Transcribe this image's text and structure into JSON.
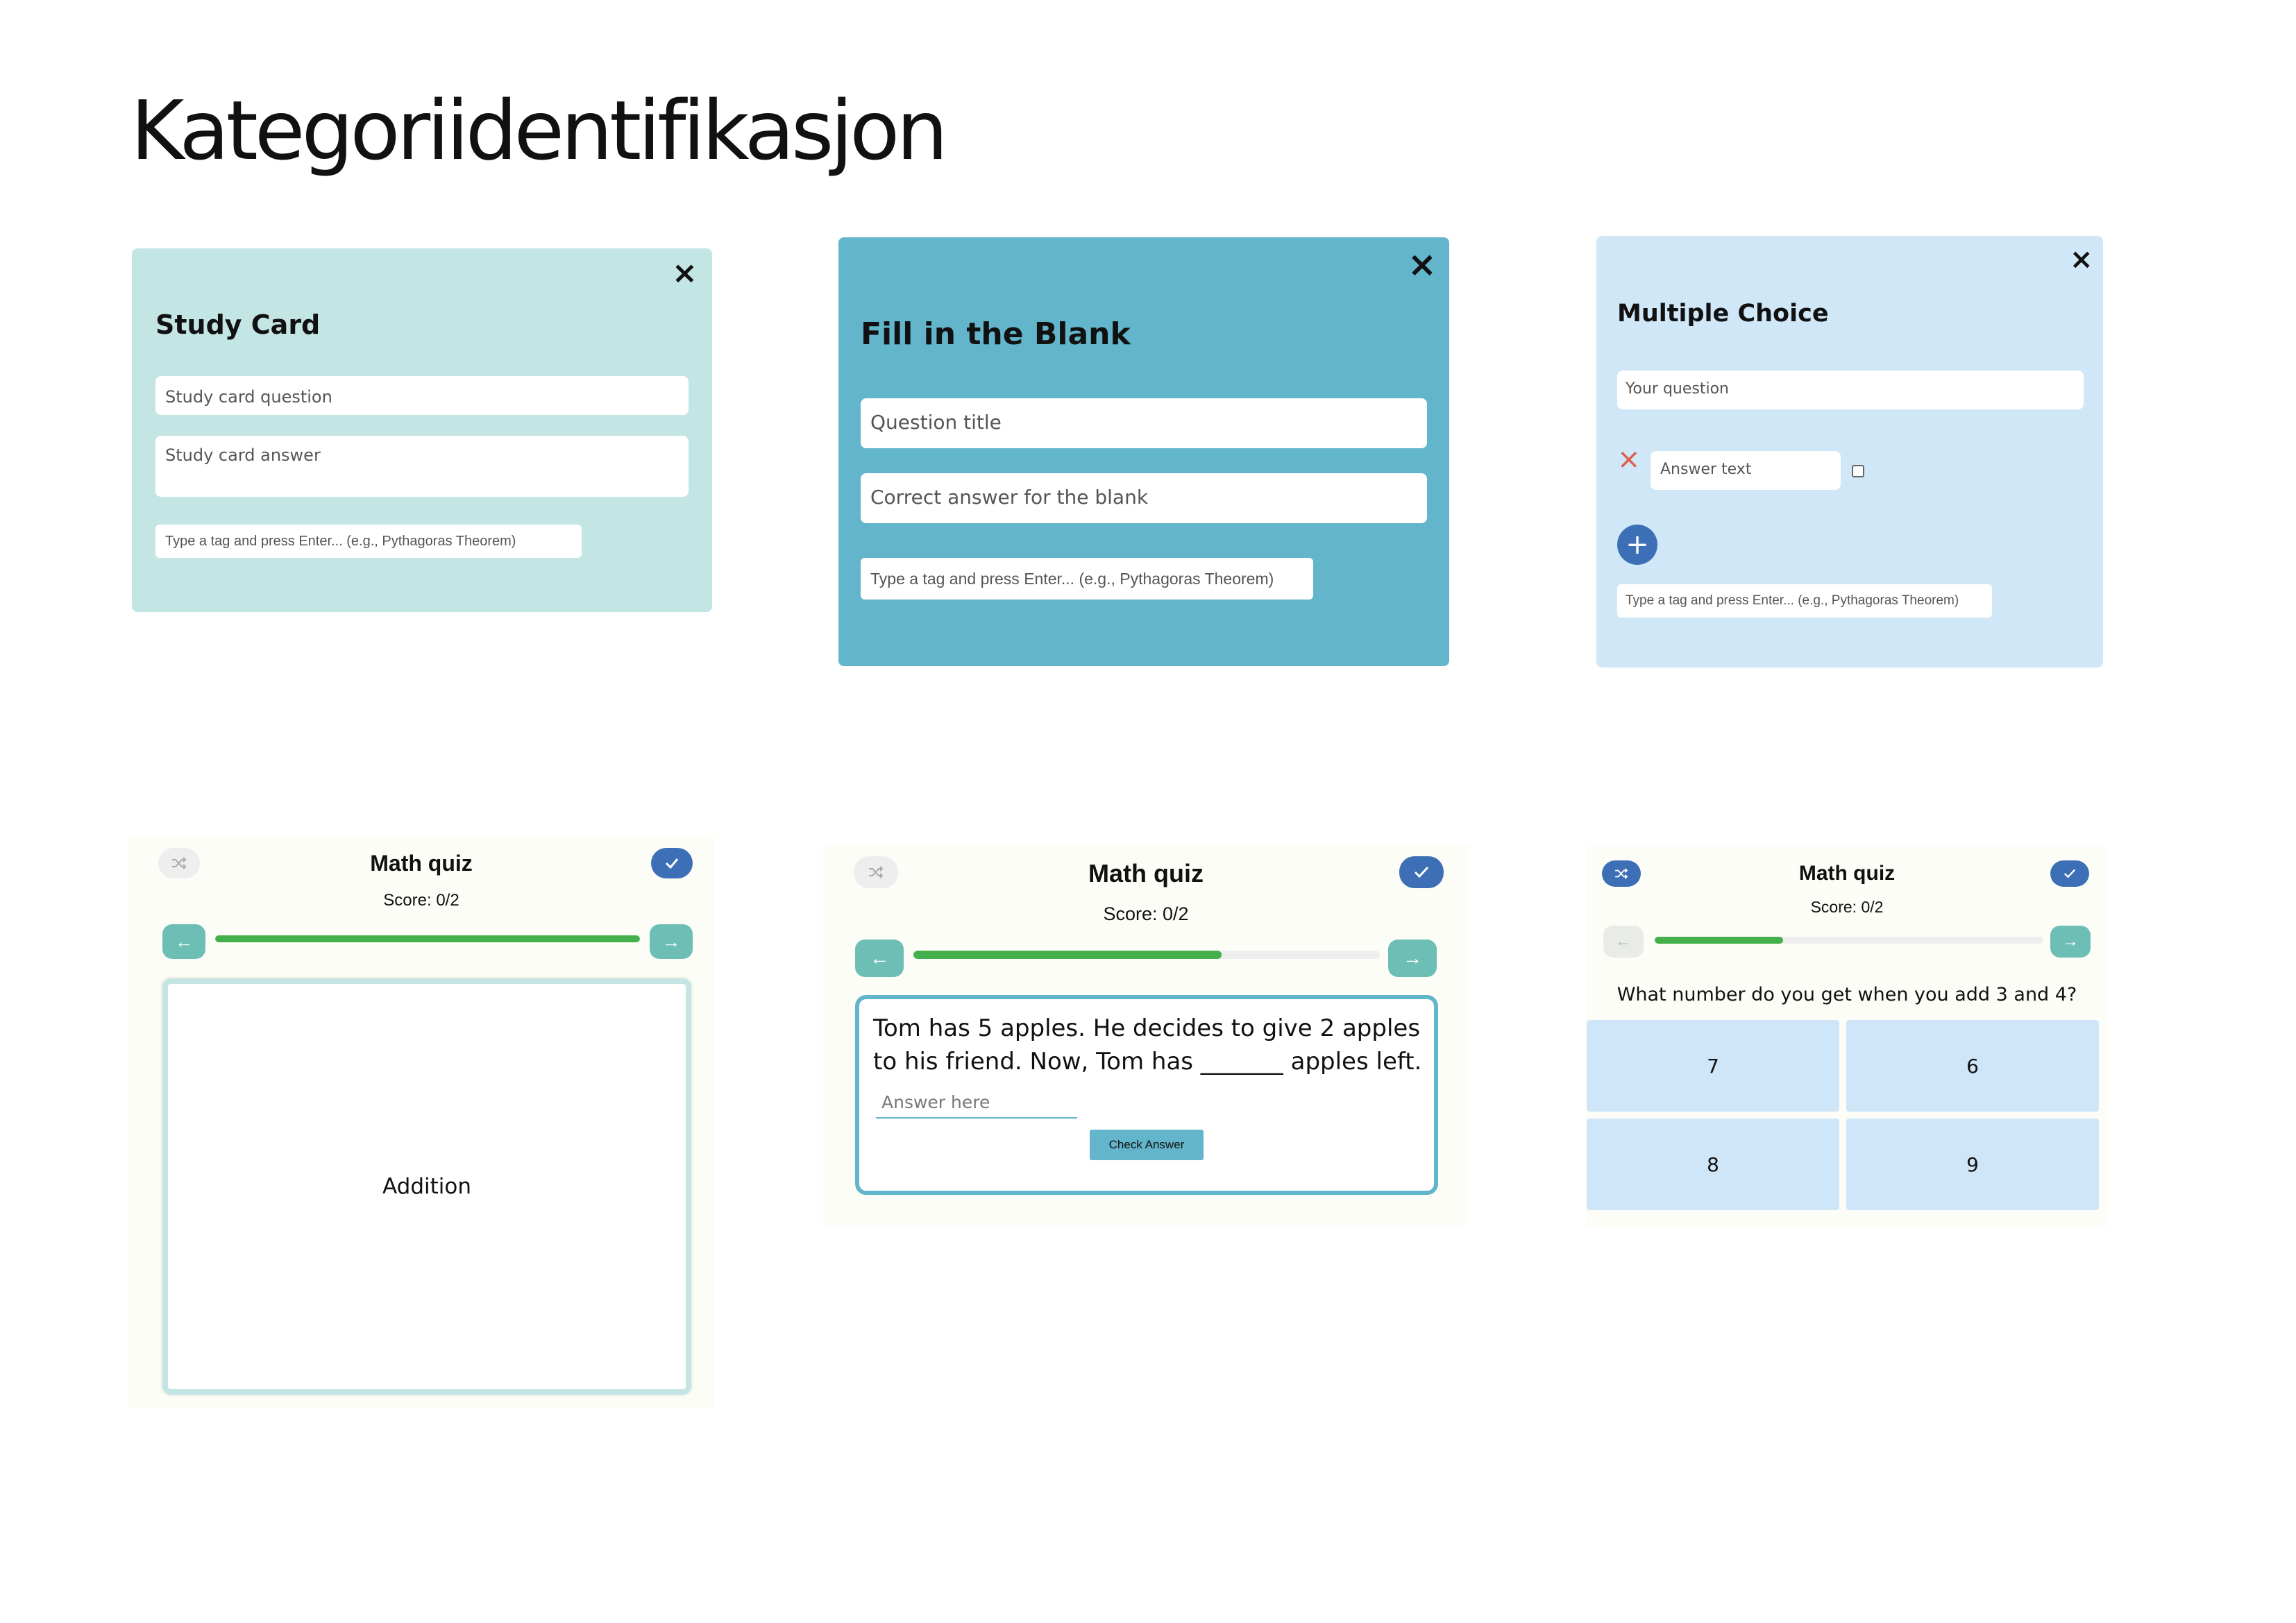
{
  "page": {
    "title": "Kategoriidentifikasjon"
  },
  "study_card": {
    "title": "Study Card",
    "question_placeholder": "Study card question",
    "answer_placeholder": "Study card answer",
    "tag_placeholder": "Type a tag and press Enter... (e.g., Pythagoras Theorem)",
    "close_icon": "×",
    "bg_color": "#c3e5e3"
  },
  "fill_blank": {
    "title": "Fill in the Blank",
    "question_placeholder": "Question title",
    "answer_placeholder": "Correct answer for the blank",
    "tag_placeholder": "Type a tag and press Enter... (e.g., Pythagoras Theorem)",
    "close_icon": "×",
    "bg_color": "#63b5cb"
  },
  "multiple_choice": {
    "title": "Multiple Choice",
    "question_placeholder": "Your question",
    "answer_placeholder": "Answer text",
    "remove_icon": "×",
    "add_icon": "+",
    "tag_placeholder": "Type a tag and press Enter... (e.g., Pythagoras Theorem)",
    "close_icon": "×",
    "bg_color": "#cfe7f7"
  },
  "quiz_study": {
    "title": "Math quiz",
    "score": "Score: 0/2",
    "progress": 1.0,
    "card_text": "Addition",
    "shuffle_icon": "shuffle-icon",
    "finish_icon": "check-icon"
  },
  "quiz_blank": {
    "title": "Math quiz",
    "score": "Score: 0/2",
    "progress": 0.66,
    "question": "Tom has 5 apples. He decides to give 2 apples to his friend. Now, Tom has _______ apples left.",
    "answer_placeholder": "Answer here",
    "check_label": "Check Answer"
  },
  "quiz_mc": {
    "title": "Math quiz",
    "score": "Score: 0/2",
    "progress": 0.33,
    "question": "What number do you get when you add 3 and 4?",
    "options": [
      "7",
      "6",
      "8",
      "9"
    ]
  },
  "colors": {
    "accent_blue": "#3d6fb6",
    "nav_teal": "#6dbfb5",
    "progress_green": "#43b04c",
    "remove_red": "#e05a4a"
  }
}
